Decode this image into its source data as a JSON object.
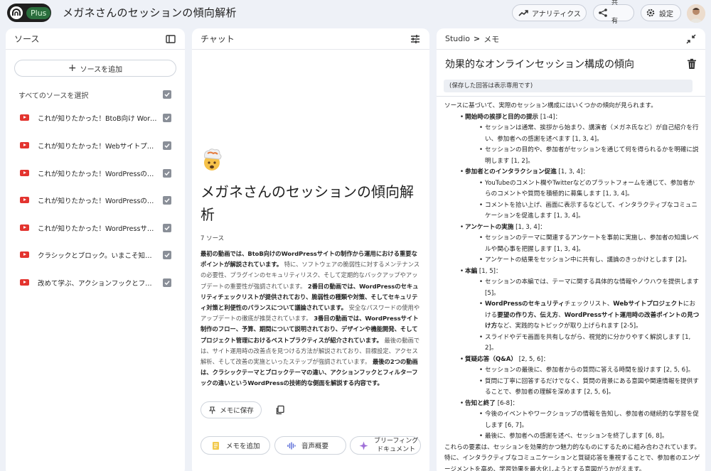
{
  "header": {
    "plan_badge": "Plus",
    "notebook_title": "メガネさんのセッションの傾向解析",
    "analytics_label": "アナリティクス",
    "share_label_1": "共",
    "share_label_2": "有",
    "settings_label": "設定"
  },
  "sources": {
    "title": "ソース",
    "add_label": "ソースを追加",
    "select_all_label": "すべてのソースを選択",
    "items": [
      {
        "label": "これが知りたかった！BtoB向け WordPressサイト"
      },
      {
        "label": "これが知りたかった！Webサイトプロジェクト"
      },
      {
        "label": "これが知りたかった！WordPressのセキュリティ"
      },
      {
        "label": "これが知りたかった！WordPressの運用"
      },
      {
        "label": "これが知りたかった！WordPressサイト制作"
      },
      {
        "label": "クラシックとブロック。いまこそ知りたい"
      },
      {
        "label": "改めて学ぶ、アクションフックとフィルターフック"
      }
    ]
  },
  "chat": {
    "title": "チャット",
    "notebook_title": "メガネさんのセッションの傾向解析",
    "source_count": "7 ソース",
    "summary": [
      {
        "t": "最初の動画では、BtoB向けのWordPressサイトの制作から運用における重要なポイントが解説されています。",
        "b": true
      },
      {
        "t": "特に、ソフトウェアの脆弱性に対するメンテナンスの必要性、プラグインのセキュリティリスク、そして定期的なバックアップやアップデートの重要性が強調されています。",
        "b": false
      },
      {
        "t": "2番目の動画では、WordPressのセキュリティチェックリストが提供されており、脆弱性の種類や対策、そしてセキュリティ対策と利便性のバランスについて議論されています。",
        "b": true
      },
      {
        "t": "安全なパスワードの使用やアップデートの徹底が推奨されています。",
        "b": false
      },
      {
        "t": "3番目の動画では、WordPressサイト制作のフロー、予算、期間について説明されており、デザインや機能開発、そしてプロジェクト管理におけるベストプラクティスが紹介されています。",
        "b": true
      },
      {
        "t": "最後の動画では、サイト運用時の改善点を見つける方法が解説されており、目標設定、アクセス解析、そして改善の実施といったステップが強調されています。",
        "b": false
      },
      {
        "t": "最後の2つの動画は、クラシックテーマとブロックテーマの違い、アクションフックとフィルターフックの違いというWordPressの技術的な側面を解説する内容です。",
        "b": true
      }
    ],
    "save_label": "メモに保存",
    "add_memo_label": "メモを追加",
    "audio_label": "音声概要",
    "brief_label_1": "ブリーフィング",
    "brief_label_2": "ドキュメント"
  },
  "studio": {
    "crumb_root": "Studio",
    "crumb_sep": ">",
    "crumb_leaf": "メモ",
    "memo_title": "効果的なオンラインセッション構成の傾向",
    "readonly_note": "(保存した回答は表示専用です)",
    "memo_lines": [
      {
        "lv": 0,
        "segs": [
          {
            "t": "ソースに基づいて、実際のセッション構成にはいくつかの傾向が見られます。"
          }
        ]
      },
      {
        "lv": 1,
        "segs": [
          {
            "t": "開始時の挨拶と目的の提示",
            "b": true
          },
          {
            "t": " [1-4]："
          }
        ]
      },
      {
        "lv": 2,
        "segs": [
          {
            "t": "セッションは通常、挨拶から始まり、講演者（メガネ氏など）が自己紹介を行い、参加者への感謝を述べます [1, 3, 4]。"
          }
        ]
      },
      {
        "lv": 2,
        "segs": [
          {
            "t": "セッションの目的や、参加者がセッションを通じて何を得られるかを明確に説明します [1, 2]。"
          }
        ]
      },
      {
        "lv": 1,
        "segs": [
          {
            "t": "参加者とのインタラクション促進",
            "b": true
          },
          {
            "t": " [1, 3, 4]："
          }
        ]
      },
      {
        "lv": 2,
        "segs": [
          {
            "t": "YouTubeのコメント欄やTwitterなどのプラットフォームを通じて、参加者からのコメントや質問を積極的に募集します [1, 3, 4]。"
          }
        ]
      },
      {
        "lv": 2,
        "segs": [
          {
            "t": "コメントを拾い上げ、画面に表示するなどして、インタラクティブなコミュニケーションを促進します [1, 3, 4]。"
          }
        ]
      },
      {
        "lv": 1,
        "segs": [
          {
            "t": "アンケートの実施",
            "b": true
          },
          {
            "t": " [1, 3, 4]："
          }
        ]
      },
      {
        "lv": 2,
        "segs": [
          {
            "t": "セッションのテーマに関連するアンケートを事前に実施し、参加者の知識レベルや関心事を把握します [1, 3, 4]。"
          }
        ]
      },
      {
        "lv": 2,
        "segs": [
          {
            "t": "アンケートの結果をセッション中に共有し、議論のきっかけとします [2]。"
          }
        ]
      },
      {
        "lv": 1,
        "segs": [
          {
            "t": "本編",
            "b": true
          },
          {
            "t": " [1, 5]："
          }
        ]
      },
      {
        "lv": 2,
        "segs": [
          {
            "t": "セッションの本編では、テーマに関する具体的な情報やノウハウを提供します [5]。"
          }
        ]
      },
      {
        "lv": 2,
        "segs": [
          {
            "t": "WordPressのセキュリティ",
            "b": true
          },
          {
            "t": "チェックリスト、"
          },
          {
            "t": "Webサイトプロジェクト",
            "b": true
          },
          {
            "t": "における"
          },
          {
            "t": "要望の作り方、伝え方",
            "b": true
          },
          {
            "t": "、"
          },
          {
            "t": "WordPressサイト運用時の改善ポイントの見つけ方",
            "b": true
          },
          {
            "t": "など、実践的なトピックが取り上げられます [2-5]。"
          }
        ]
      },
      {
        "lv": 2,
        "segs": [
          {
            "t": "スライドやデモ画面を共有しながら、視覚的に分かりやすく解説します [1, 2]。"
          }
        ]
      },
      {
        "lv": 1,
        "segs": [
          {
            "t": "質疑応答（Q&A）",
            "b": true
          },
          {
            "t": " [2, 5, 6]："
          }
        ]
      },
      {
        "lv": 2,
        "segs": [
          {
            "t": "セッションの最後に、参加者からの質問に答える時間を設けます [2, 5, 6]。"
          }
        ]
      },
      {
        "lv": 2,
        "segs": [
          {
            "t": "質問に丁寧に回答するだけでなく、質問の背景にある意図や関連情報を提供することで、参加者の理解を深めます [2, 5, 6]。"
          }
        ]
      },
      {
        "lv": 1,
        "segs": [
          {
            "t": "告知と終了",
            "b": true
          },
          {
            "t": " [6-8]："
          }
        ]
      },
      {
        "lv": 2,
        "segs": [
          {
            "t": "今後のイベントやワークショップの情報を告知し、参加者の継続的な学習を促します [6, 7]。"
          }
        ]
      },
      {
        "lv": 2,
        "segs": [
          {
            "t": "最後に、参加者への感謝を述べ、セッションを終了します [6, 8]。"
          }
        ]
      },
      {
        "lv": 0,
        "segs": [
          {
            "t": "これらの要素は、セッションを効果的かつ魅力的なものにするために組み合わされています。特に、インタラクティブなコミュニケーションと質疑応答を重視することで、参加者のエンゲージメントを高め、学習効果を最大化しようとする意図がうかがえます。"
          }
        ]
      }
    ]
  },
  "colors": {
    "background": "#eef1f7",
    "youtube": "#e3342f",
    "plus_badge": "#2a6e3d"
  },
  "icons": [
    "notebooklm-logo-icon",
    "trending-up-icon",
    "share-icon",
    "gear-icon",
    "avatar",
    "sidebar-toggle-icon",
    "tune-icon",
    "collapse-icon",
    "trash-icon",
    "pin-icon",
    "copy-icon",
    "memo-icon",
    "audio-waveform-icon",
    "sparkle-icon",
    "youtube-icon",
    "checkbox-checked-icon"
  ]
}
